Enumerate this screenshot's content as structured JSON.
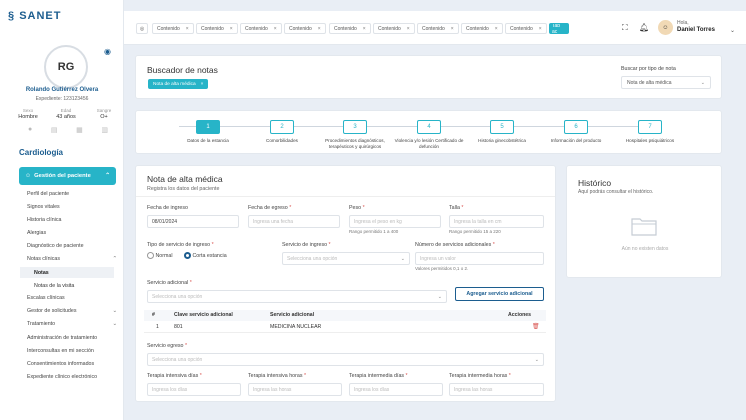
{
  "brand": "SANET",
  "patient": {
    "initials": "RG",
    "name": "Rolando Gutiérrez Olvera",
    "expediente": "Expediente: 123123456",
    "sexo_label": "Sexo",
    "sexo": "Hombre",
    "edad_label": "Edad",
    "edad": "43 años",
    "sangre_label": "Sangre",
    "sangre": "O+"
  },
  "sidebar": {
    "section": "Cardiología",
    "active": "Gestión del paciente",
    "items": [
      "Perfil del paciente",
      "Signos vitales",
      "Historia clínica",
      "Alergias",
      "Diagnóstico de paciente",
      "Notas clínicas"
    ],
    "subitems": [
      "Notas",
      "Notas de la visita"
    ],
    "items2": [
      "Escalas clínicas",
      "Gestor de solicitudes",
      "Tratamiento",
      "Administración de tratamiento",
      "Interconsultas en mi sección",
      "Consentimientos informados",
      "Expediente clínico electrónico"
    ]
  },
  "topbar": {
    "tabs": [
      "Contenido",
      "Contenido",
      "Contenido",
      "Contenido",
      "Contenido",
      "Contenido",
      "Contenido",
      "Contenido",
      "Contenido"
    ],
    "active_tab": "Tab ac",
    "greeting": "Hola,",
    "user": "Daniel Torres"
  },
  "buscador": {
    "title": "Buscador de notas",
    "chip": "Nota de alta médica",
    "filter_label": "Buscar por tipo de nota",
    "filter_value": "Nota de alta médica"
  },
  "steps": [
    {
      "n": "1",
      "label": "Datos de la estancia"
    },
    {
      "n": "2",
      "label": "Comorbilidades"
    },
    {
      "n": "3",
      "label": "Procedimientos diagnósticos, terapéuticos y quirúrgicos"
    },
    {
      "n": "4",
      "label": "Violencia y/o lesión Certificado de defunción"
    },
    {
      "n": "5",
      "label": "Historia ginecobstétrica"
    },
    {
      "n": "6",
      "label": "Información del producto"
    },
    {
      "n": "7",
      "label": "Hospitales psiquiátricos"
    }
  ],
  "form": {
    "title": "Nota de alta médica",
    "subtitle": "Registra los datos del paciente",
    "fecha_ingreso_label": "Fecha de ingreso",
    "fecha_ingreso": "08/01/2024",
    "fecha_egreso_label": "Fecha de egreso",
    "fecha_egreso_ph": "Ingresa una fecha",
    "peso_label": "Peso",
    "peso_ph": "Ingresa el peso en kg",
    "peso_hint": "Rango permitido 1 a 400",
    "talla_label": "Talla",
    "talla_ph": "Ingresa la talla en cm",
    "talla_hint": "Rango permitido 15 a 220",
    "tipo_label": "Tipo de servicio de ingreso",
    "opt_normal": "Normal",
    "opt_corta": "Corta estancia",
    "servicio_ingreso_label": "Servicio de ingreso",
    "servicio_ingreso_ph": "Selecciona una opción",
    "num_serv_label": "Número de servicios adicionales",
    "num_serv_ph": "Ingresa un valor",
    "num_serv_hint": "Valores permitidos 0,1 o 2.",
    "serv_adic_label": "Servicio adicional",
    "serv_adic_ph": "Selecciona una opción",
    "add_btn": "Agregar servicio adicional",
    "table": {
      "headers": [
        "#",
        "Clave servicio adicional",
        "Servicio adicional",
        "Acciones"
      ],
      "rows": [
        [
          "1",
          "801",
          "MEDICINA NUCLEAR"
        ]
      ]
    },
    "serv_egreso_label": "Servicio egreso",
    "serv_egreso_ph": "Selecciona una opción",
    "t1_label": "Terapia intensiva días",
    "t1_ph": "Ingresa los días",
    "t2_label": "Terapia intensiva horas",
    "t2_ph": "Ingresa las horas",
    "t3_label": "Terapia intermedia días",
    "t3_ph": "Ingresa los días",
    "t4_label": "Terapia intermedia horas",
    "t4_ph": "Ingresa las horas"
  },
  "historico": {
    "title": "Histórico",
    "subtitle": "Aquí podrás consultar el histórico.",
    "empty": "Aún no existen datos"
  }
}
